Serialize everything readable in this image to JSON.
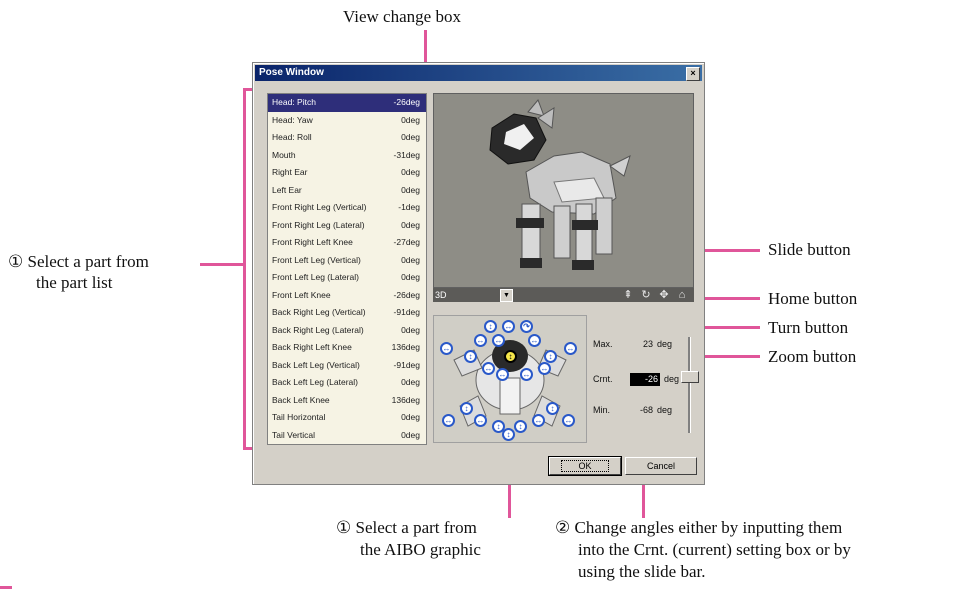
{
  "window": {
    "title": "Pose Window",
    "close_glyph": "×"
  },
  "parts": [
    {
      "name": "Head: Pitch",
      "value": "-26deg"
    },
    {
      "name": "Head: Yaw",
      "value": "0deg"
    },
    {
      "name": "Head: Roll",
      "value": "0deg"
    },
    {
      "name": "Mouth",
      "value": "-31deg"
    },
    {
      "name": "Right Ear",
      "value": "0deg"
    },
    {
      "name": "Left Ear",
      "value": "0deg"
    },
    {
      "name": "Front Right Leg (Vertical)",
      "value": "-1deg"
    },
    {
      "name": "Front Right Leg (Lateral)",
      "value": "0deg"
    },
    {
      "name": "Front Right Left Knee",
      "value": "-27deg"
    },
    {
      "name": "Front Left Leg (Vertical)",
      "value": "0deg"
    },
    {
      "name": "Front Left Leg (Lateral)",
      "value": "0deg"
    },
    {
      "name": "Front Left Knee",
      "value": "-26deg"
    },
    {
      "name": "Back Right Leg (Vertical)",
      "value": "-91deg"
    },
    {
      "name": "Back Right Leg (Lateral)",
      "value": "0deg"
    },
    {
      "name": "Back Right Left Knee",
      "value": "136deg"
    },
    {
      "name": "Back Left Leg (Vertical)",
      "value": "-91deg"
    },
    {
      "name": "Back Left Leg (Lateral)",
      "value": "0deg"
    },
    {
      "name": "Back Left Knee",
      "value": "136deg"
    },
    {
      "name": "Tail Horizontal",
      "value": "0deg"
    },
    {
      "name": "Tail Vertical",
      "value": "0deg"
    }
  ],
  "view": {
    "mode": "3D"
  },
  "view_buttons": [
    {
      "icon": "zoom-icon",
      "glyph": "⇞"
    },
    {
      "icon": "turn-icon",
      "glyph": "↻"
    },
    {
      "icon": "slide-icon",
      "glyph": "✥"
    },
    {
      "icon": "home-icon",
      "glyph": "⌂"
    }
  ],
  "angle": {
    "max_label": "Max.",
    "max_value": "23",
    "max_unit": "deg",
    "crnt_label": "Crnt.",
    "crnt_value": "-26",
    "crnt_unit": "deg",
    "min_label": "Min.",
    "min_value": "-68",
    "min_unit": "deg"
  },
  "buttons": {
    "ok": "OK",
    "cancel": "Cancel"
  },
  "callouts": {
    "view_change_box": "View change box",
    "select_part_list_line1": "① Select a part from",
    "select_part_list_line2": "the part list",
    "slide_button": "Slide button",
    "home_button": "Home button",
    "turn_button": "Turn button",
    "zoom_button": "Zoom button",
    "select_graphic_line1": "① Select a part from",
    "select_graphic_line2": "the AIBO graphic",
    "change_angles_line1": "② Change angles either by inputting them",
    "change_angles_line2": "into the Crnt. (current) setting box or by",
    "change_angles_line3": "using the slide bar."
  },
  "colors": {
    "accent": "#e0569a",
    "selected_row": "#2e2e7a",
    "joint_button": "#2a59c9"
  }
}
